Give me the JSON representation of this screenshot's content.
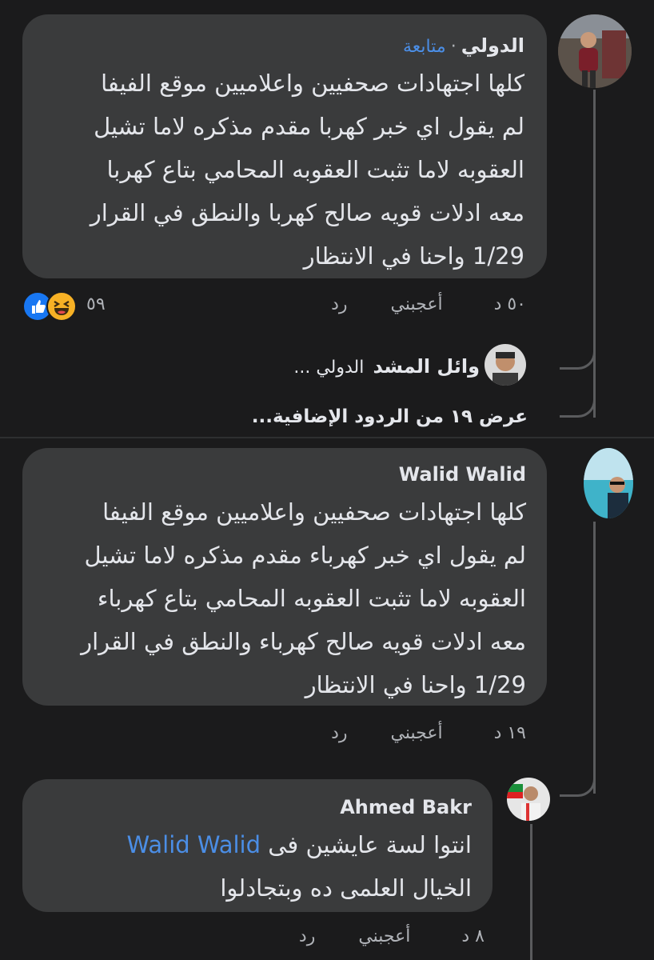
{
  "comment1": {
    "author": "الدولي",
    "follow_label": "متابعة",
    "separator": "·",
    "lines": [
      "كلها اجتهادات صحفيين واعلاميين موقع الفيفا",
      "لم يقول اي خبر كهربا مقدم مذكره لاما تشيل",
      "العقوبه لاما تثبت العقوبه المحامي بتاع كهربا",
      "معه ادلات قويه صالح كهربا والنطق في القرار",
      "1/29 واحنا في الانتظار"
    ],
    "time": "٥٠ د",
    "like_label": "أعجبني",
    "reply_label": "رد",
    "reaction_count": "٥٩"
  },
  "reply_preview": {
    "author": "وائل المشد",
    "snippet": "الدولي ..."
  },
  "more_replies_label": "عرض ١٩ من الردود الإضافية...",
  "comment2": {
    "author": "Walid Walid",
    "lines": [
      "كلها اجتهادات صحفيين واعلاميين موقع الفيفا",
      "لم يقول اي خبر كهرباء مقدم مذكره لاما تشيل",
      "العقوبه لاما تثبت العقوبه المحامي بتاع كهرباء",
      "معه ادلات قويه صالح كهرباء والنطق في القرار",
      "1/29 واحنا في الانتظار"
    ],
    "time": "١٩ د",
    "like_label": "أعجبني",
    "reply_label": "رد"
  },
  "comment3": {
    "author": "Ahmed Bakr",
    "mention": "Walid Walid",
    "line1_rest": "انتوا لسة عايشين فى",
    "line2": "الخيال العلمى ده وبتجادلوا",
    "time": "٨ د",
    "like_label": "أعجبني",
    "reply_label": "رد"
  },
  "colors": {
    "background": "#1b1b1c",
    "bubble": "#3a3b3c",
    "text": "#e4e6eb",
    "secondary": "#b0b3b8",
    "link": "#4b8ee6",
    "like_reaction": "#1877f2",
    "haha_reaction": "#f7b125"
  },
  "icons": [
    "like-reaction-icon",
    "haha-reaction-icon"
  ]
}
